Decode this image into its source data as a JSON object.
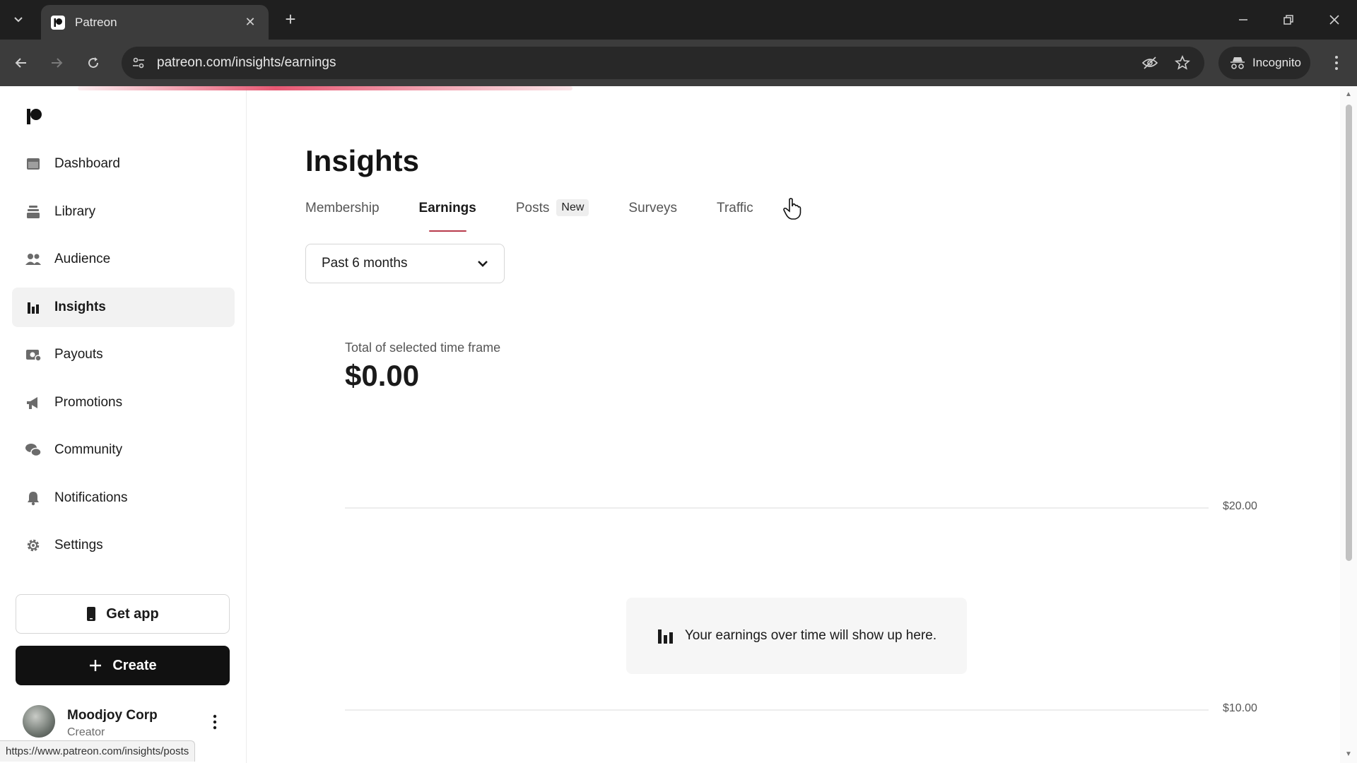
{
  "browser": {
    "tab_title": "Patreon",
    "url": "patreon.com/insights/earnings",
    "incognito_label": "Incognito",
    "status_url": "https://www.patreon.com/insights/posts"
  },
  "sidebar": {
    "items": [
      {
        "label": "Dashboard",
        "icon": "dashboard-icon"
      },
      {
        "label": "Library",
        "icon": "library-icon"
      },
      {
        "label": "Audience",
        "icon": "audience-icon"
      },
      {
        "label": "Insights",
        "icon": "insights-icon",
        "active": true
      },
      {
        "label": "Payouts",
        "icon": "payouts-icon"
      },
      {
        "label": "Promotions",
        "icon": "megaphone-icon"
      },
      {
        "label": "Community",
        "icon": "community-icon"
      },
      {
        "label": "Notifications",
        "icon": "bell-icon"
      },
      {
        "label": "Settings",
        "icon": "gear-icon"
      }
    ],
    "get_app_label": "Get app",
    "create_label": "Create",
    "user": {
      "name": "Moodjoy Corp",
      "role": "Creator"
    }
  },
  "main": {
    "title": "Insights",
    "tabs": [
      {
        "label": "Membership"
      },
      {
        "label": "Earnings",
        "active": true
      },
      {
        "label": "Posts",
        "badge": "New"
      },
      {
        "label": "Surveys"
      },
      {
        "label": "Traffic"
      }
    ],
    "range_select": {
      "value": "Past 6 months"
    },
    "total_label": "Total of selected time frame",
    "total_value": "$0.00",
    "chart": {
      "y_labels": [
        "$20.00",
        "$10.00"
      ],
      "empty_message": "Your earnings over time will show up here."
    }
  },
  "colors": {
    "accent": "#b83a4b",
    "create_button": "#111111",
    "browser_dark": "#1f1f1f"
  }
}
